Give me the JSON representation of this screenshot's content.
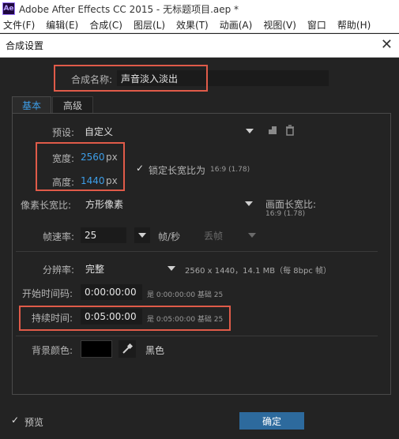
{
  "app": {
    "logo": "Ae",
    "title": "Adobe After Effects CC 2015 - 无标题项目.aep *"
  },
  "menu": [
    "文件(F)",
    "编辑(E)",
    "合成(C)",
    "图层(L)",
    "效果(T)",
    "动画(A)",
    "视图(V)",
    "窗口",
    "帮助(H)"
  ],
  "dialog": {
    "title": "合成设置",
    "close": "✕",
    "name_label": "合成名称:",
    "name_value": "声音淡入淡出",
    "tabs": [
      "基本",
      "高级"
    ],
    "preset_label": "预设:",
    "preset_value": "自定义",
    "width_label": "宽度:",
    "width_value": "2560",
    "width_unit": "px",
    "height_label": "高度:",
    "height_value": "1440",
    "height_unit": "px",
    "lock_label": "锁定长宽比为",
    "lock_ratio": "16:9 (1.78)",
    "pixel_aspect_label": "像素长宽比:",
    "pixel_aspect_value": "方形像素",
    "frame_aspect_label": "画面长宽比:",
    "frame_aspect_value": "16:9 (1.78)",
    "framerate_label": "帧速率:",
    "framerate_value": "25",
    "framerate_unit": "帧/秒",
    "drop_frame": "丢帧",
    "resolution_label": "分辨率:",
    "resolution_value": "完整",
    "resolution_info": "2560 x 1440，14.1 MB（每 8bpc 帧）",
    "start_tc_label": "开始时间码:",
    "start_tc_value": "0:00:00:00",
    "start_tc_info": "是 0:00:00:00  基础 25",
    "duration_label": "持续时间:",
    "duration_value": "0:05:00:00",
    "duration_info": "是 0:05:00:00  基础 25",
    "bg_color_label": "背景颜色:",
    "bg_color_name": "黑色",
    "bg_color": "#000000",
    "preview_label": "预览",
    "ok_label": "确定",
    "check_mark": "✓"
  }
}
